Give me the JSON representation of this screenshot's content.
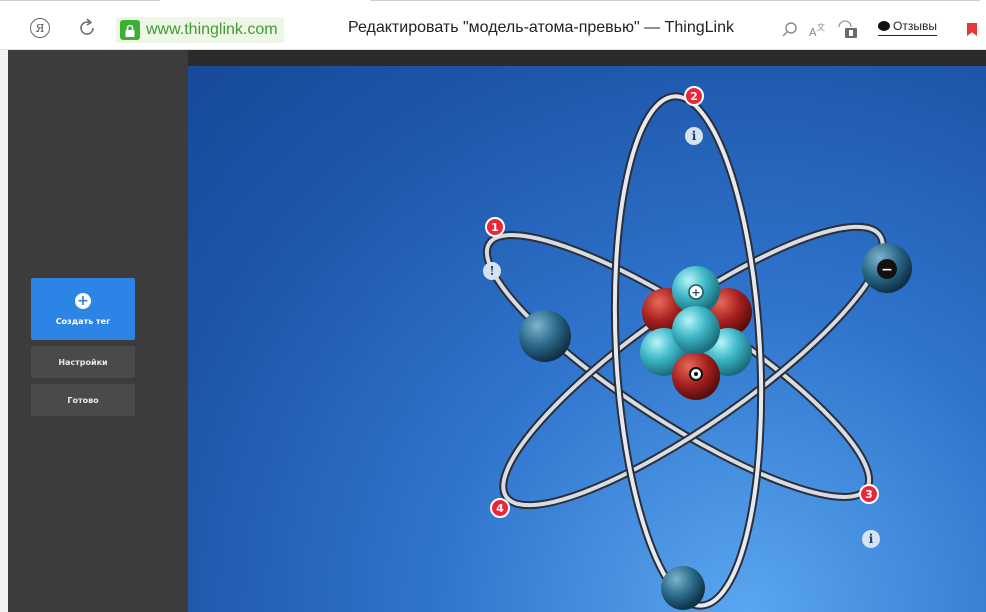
{
  "browser": {
    "url": "www.thinglink.com",
    "page_title": "Редактировать \"модель-атома-превью\" — ThingLink",
    "feedback_label": "Отзывы",
    "yandex_glyph": "Я",
    "icons": [
      "yandex-icon",
      "reload-icon",
      "lock-icon",
      "search-icon",
      "translate-icon",
      "extension-icon",
      "feedback-icon",
      "bookmark-icon"
    ]
  },
  "sidebar": {
    "create_tag_label": "Создать тег",
    "create_tag_glyph": "+",
    "settings_label": "Настройки",
    "done_label": "Готово"
  },
  "canvas": {
    "tags": [
      {
        "label": "1"
      },
      {
        "label": "2"
      },
      {
        "label": "3"
      },
      {
        "label": "4"
      }
    ],
    "info_glyph": "i",
    "alert_glyph": "!",
    "electron_minus": "−",
    "nucleus_plus": "+",
    "colors": {
      "tag": "#e8283a",
      "proton": "#b52a2a",
      "neutron": "#3fb9c9",
      "electron": "#2a6a8a",
      "background": "#1d56aa"
    }
  }
}
